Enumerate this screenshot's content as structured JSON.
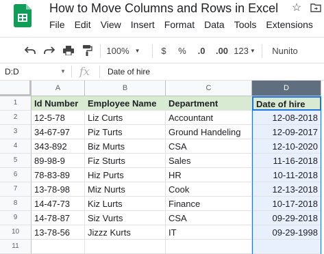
{
  "app": {
    "title": "How to Move Columns and Rows in Excel",
    "logo_icon": "google-sheets-logo",
    "accent": "#0f9d58"
  },
  "menu": [
    "File",
    "Edit",
    "View",
    "Insert",
    "Format",
    "Data",
    "Tools",
    "Extensions"
  ],
  "toolbar": {
    "zoom": "100%",
    "currency": "$",
    "percent": "%",
    "decrease_decimal": ".0",
    "increase_decimal": ".00",
    "number_format": "123",
    "font": "Nunito"
  },
  "formula_bar": {
    "name_box": "D:D",
    "fx": "fx",
    "value": "Date of hire"
  },
  "grid": {
    "columns": [
      "A",
      "B",
      "C",
      "D"
    ],
    "selected_column": "D",
    "rows": [
      "1",
      "2",
      "3",
      "4",
      "5",
      "6",
      "7",
      "8",
      "9",
      "10",
      "11"
    ],
    "headers": [
      "Id Number",
      "Employee Name",
      "Department",
      "Date of hire"
    ],
    "data": [
      [
        "12-5-78",
        "Liz Curts",
        "Accountant",
        "12-08-2018"
      ],
      [
        "34-67-97",
        "Piz Turts",
        "Ground Handeling",
        "12-09-2017"
      ],
      [
        "343-892",
        "Biz Murts",
        "CSA",
        "12-10-2020"
      ],
      [
        "89-98-9",
        "Fiz Sturts",
        "Sales",
        "11-16-2018"
      ],
      [
        "78-83-89",
        "Hiz Purts",
        "HR",
        "10-11-2018"
      ],
      [
        "13-78-98",
        "Miz Nurts",
        "Cook",
        "12-13-2018"
      ],
      [
        "14-47-73",
        "Kiz Lurts",
        "Finance",
        "10-17-2018"
      ],
      [
        "14-78-87",
        "Siz Vurts",
        "CSA",
        "09-29-2018"
      ],
      [
        "13-78-56",
        "Jizzz Kurts",
        "IT",
        "09-29-1998"
      ]
    ],
    "header_fill": "#d9ead3",
    "selection_color": "#1a73e8"
  }
}
